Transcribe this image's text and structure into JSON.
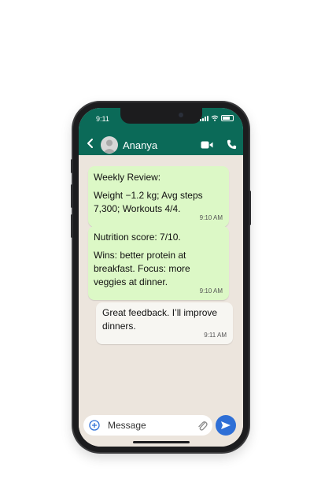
{
  "status_bar": {
    "time": "9:11"
  },
  "header": {
    "contact_name": "Ananya",
    "icons": [
      "back-icon",
      "avatar",
      "video-call-icon",
      "phone-call-icon"
    ]
  },
  "messages": [
    {
      "direction": "incoming",
      "title": "Weekly Review:",
      "body": "Weight −1.2 kg; Avg steps 7,300; Workouts 4/4.",
      "time": "9:10 AM"
    },
    {
      "direction": "incoming",
      "title": "Nutrition score: 7/10.",
      "body": "Wins: better protein at breakfast. Focus: more veggies at dinner.",
      "time": "9:10 AM"
    },
    {
      "direction": "outgoing",
      "body": "Great feedback. I’ll improve dinners.",
      "time": "9:11 AM"
    }
  ],
  "composer": {
    "placeholder": "Message"
  },
  "colors": {
    "header": "#0b6a58",
    "incoming_bubble": "#dcf8c6",
    "outgoing_bubble": "#f7f6f2",
    "chat_bg": "#ece5dd",
    "send_button": "#2f6fd6"
  }
}
